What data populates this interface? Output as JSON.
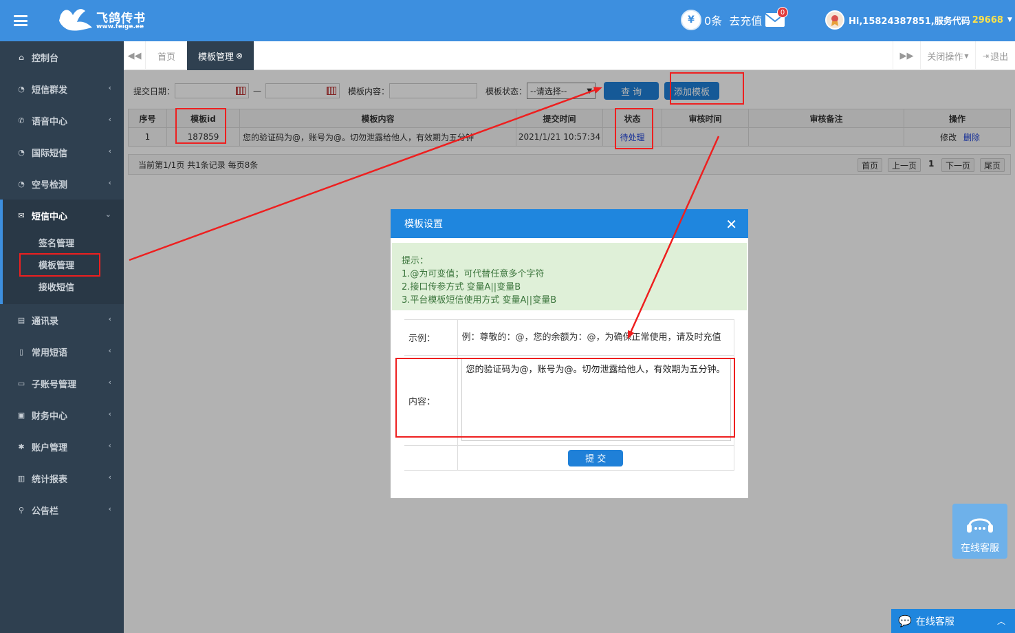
{
  "header": {
    "logo_text": "飞鸽传书",
    "logo_sub": "www.feige.ee",
    "coin_symbol": "¥",
    "balance": "0条",
    "recharge": "去充值",
    "mail_badge": "0",
    "user_greeting": "Hi,15824387851,服务代码",
    "service_code": "29668"
  },
  "sidebar": {
    "items": [
      {
        "label": "控制台",
        "icon": "home-icon"
      },
      {
        "label": "短信群发",
        "icon": "gauge-icon"
      },
      {
        "label": "语音中心",
        "icon": "phone-icon"
      },
      {
        "label": "国际短信",
        "icon": "gauge-icon"
      },
      {
        "label": "空号检测",
        "icon": "gauge-icon"
      },
      {
        "label": "短信中心",
        "icon": "envelope-icon"
      },
      {
        "label": "通讯录",
        "icon": "book-icon"
      },
      {
        "label": "常用短语",
        "icon": "file-icon"
      },
      {
        "label": "子账号管理",
        "icon": "monitor-icon"
      },
      {
        "label": "财务中心",
        "icon": "money-icon"
      },
      {
        "label": "账户管理",
        "icon": "gear-icon"
      },
      {
        "label": "统计报表",
        "icon": "bar-chart-icon"
      },
      {
        "label": "公告栏",
        "icon": "search-icon"
      }
    ],
    "sms_sub": [
      "签名管理",
      "模板管理",
      "接收短信"
    ]
  },
  "tabs": {
    "home": "首页",
    "active": "模板管理",
    "close_ops": "关闭操作",
    "logout": "退出"
  },
  "filter": {
    "date_label": "提交日期：",
    "dash": "—",
    "content_label": "模板内容：",
    "status_label": "模板状态：",
    "status_value": "--请选择--",
    "query_btn": "查 询",
    "add_btn": "添加模板"
  },
  "table": {
    "headers": [
      "序号",
      "模板id",
      "模板内容",
      "提交时间",
      "状态",
      "审核时间",
      "审核备注",
      "操作"
    ],
    "row": {
      "no": "1",
      "id": "187859",
      "content": "您的验证码为@，账号为@。切勿泄露给他人，有效期为五分钟",
      "time": "2021/1/21 10:57:34",
      "status": "待处理",
      "audit_time": "",
      "audit_note": "",
      "edit": "修改",
      "delete": "删除"
    }
  },
  "pager": {
    "info": "当前第1/1页 共1条记录 每页8条",
    "first": "首页",
    "prev": "上一页",
    "current": "1",
    "next": "下一页",
    "last": "尾页"
  },
  "modal": {
    "title": "模板设置",
    "tip_title": "提示：",
    "tip1": "1.@为可变值；可代替任意多个字符",
    "tip2": "2.接口传参方式 变量A||变量B",
    "tip3": "3.平台模板短信使用方式 变量A||变量B",
    "example_label": "示例：",
    "example_text": "例：尊敬的：@，您的余额为：@，为确保正常使用，请及时充值",
    "content_label": "内容：",
    "content_value": "您的验证码为@，账号为@。切勿泄露给他人，有效期为五分钟。",
    "submit": "提 交"
  },
  "widgets": {
    "cs_widget": "在线客服",
    "cs_bar": "在线客服"
  },
  "colors": {
    "header_blue": "#3d8fdf",
    "sidebar": "#2f4050",
    "annotation_red": "#ee1f1f",
    "tip_green_bg": "#dff0d8"
  }
}
